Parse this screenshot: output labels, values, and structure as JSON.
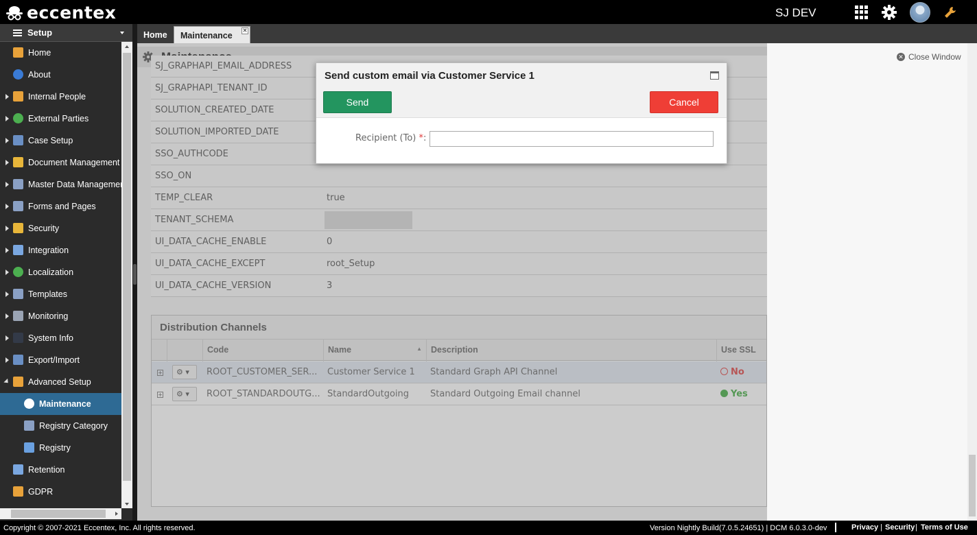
{
  "app": {
    "logo_text": "eccentex",
    "user_name": "SJ DEV"
  },
  "sidebar": {
    "header": "Setup",
    "items": [
      {
        "label": "Home",
        "icon": "home-icon",
        "color": "#e8a23a",
        "expandable": false
      },
      {
        "label": "About",
        "icon": "info-icon",
        "color": "#3a7bd5",
        "expandable": false
      },
      {
        "label": "Internal People",
        "icon": "people-icon",
        "color": "#e8a23a",
        "expandable": true
      },
      {
        "label": "External Parties",
        "icon": "globe-icon",
        "color": "#4caf50",
        "expandable": true
      },
      {
        "label": "Case Setup",
        "icon": "case-icon",
        "color": "#6a8fc4",
        "expandable": true
      },
      {
        "label": "Document Management",
        "icon": "document-icon",
        "color": "#e8b63a",
        "expandable": true
      },
      {
        "label": "Master Data Management",
        "icon": "table-icon",
        "color": "#8aa0c4",
        "expandable": true
      },
      {
        "label": "Forms and Pages",
        "icon": "form-icon",
        "color": "#8aa0c4",
        "expandable": true
      },
      {
        "label": "Security",
        "icon": "lock-icon",
        "color": "#e8b63a",
        "expandable": true
      },
      {
        "label": "Integration",
        "icon": "plug-icon",
        "color": "#7aa7e0",
        "expandable": true
      },
      {
        "label": "Localization",
        "icon": "globe-icon",
        "color": "#4caf50",
        "expandable": true
      },
      {
        "label": "Templates",
        "icon": "template-icon",
        "color": "#8aa0c4",
        "expandable": true
      },
      {
        "label": "Monitoring",
        "icon": "monitor-icon",
        "color": "#9aa4b4",
        "expandable": true
      },
      {
        "label": "System Info",
        "icon": "terminal-icon",
        "color": "#333a48",
        "expandable": true
      },
      {
        "label": "Export/Import",
        "icon": "save-icon",
        "color": "#6a8fc4",
        "expandable": true
      },
      {
        "label": "Advanced Setup",
        "icon": "wrench-icon",
        "color": "#e8a23a",
        "expandable": true,
        "open": true
      },
      {
        "label": "Maintenance",
        "icon": "gear-icon",
        "color": "#ffffff",
        "sub": true,
        "active": true
      },
      {
        "label": "Registry Category",
        "icon": "table-icon",
        "color": "#8aa0c4",
        "sub": true
      },
      {
        "label": "Registry",
        "icon": "code-icon",
        "color": "#6aa0e0",
        "sub": true
      },
      {
        "label": "Retention",
        "icon": "retention-icon",
        "color": "#7aa7e0",
        "expandable": false
      },
      {
        "label": "GDPR",
        "icon": "pencil-icon",
        "color": "#e8a23a",
        "expandable": false
      }
    ]
  },
  "tabs": {
    "home": "Home",
    "maintenance": "Maintenance"
  },
  "page": {
    "title": "Maintenance",
    "close_window": "Close Window"
  },
  "registry_rows": [
    {
      "key": "SJ_GRAPHAPI_EMAIL_ADDRESS",
      "value": ""
    },
    {
      "key": "SJ_GRAPHAPI_TENANT_ID",
      "value": ""
    },
    {
      "key": "SOLUTION_CREATED_DATE",
      "value": ""
    },
    {
      "key": "SOLUTION_IMPORTED_DATE",
      "value": ""
    },
    {
      "key": "SSO_AUTHCODE",
      "value": ""
    },
    {
      "key": "SSO_ON",
      "value": ""
    },
    {
      "key": "TEMP_CLEAR",
      "value": "true"
    },
    {
      "key": "TENANT_SCHEMA",
      "value": ""
    },
    {
      "key": "UI_DATA_CACHE_ENABLE",
      "value": "0"
    },
    {
      "key": "UI_DATA_CACHE_EXCEPT",
      "value": "root_Setup"
    },
    {
      "key": "UI_DATA_CACHE_VERSION",
      "value": "3"
    }
  ],
  "distribution": {
    "title": "Distribution Channels",
    "headers": {
      "code": "Code",
      "name": "Name",
      "description": "Description",
      "use_ssl": "Use SSL"
    },
    "rows": [
      {
        "code": "ROOT_CUSTOMER_SER...",
        "name": "Customer Service 1",
        "description": "Standard Graph API Channel",
        "use_ssl": "No"
      },
      {
        "code": "ROOT_STANDARDOUTG...",
        "name": "StandardOutgoing",
        "description": "Standard Outgoing Email channel",
        "use_ssl": "Yes"
      }
    ]
  },
  "modal": {
    "title": "Send custom email via Customer Service 1",
    "send_label": "Send",
    "cancel_label": "Cancel",
    "recipient_label": "Recipient (To)",
    "required_mark": "*",
    "recipient_value": ""
  },
  "footer": {
    "copyright": "Copyright © 2007-2021 Eccentex, Inc. All rights reserved.",
    "version": "Version   Nightly Build(7.0.5.24651) | DCM 6.0.3.0-dev",
    "privacy": "Privacy",
    "security": "Security",
    "terms": "Terms of Use"
  },
  "colors": {
    "send": "#23955f",
    "cancel": "#ef3e36",
    "active_nav": "#2e6a94",
    "ssl_no": "#e56b6b",
    "ssl_yes": "#6bbf6b"
  }
}
